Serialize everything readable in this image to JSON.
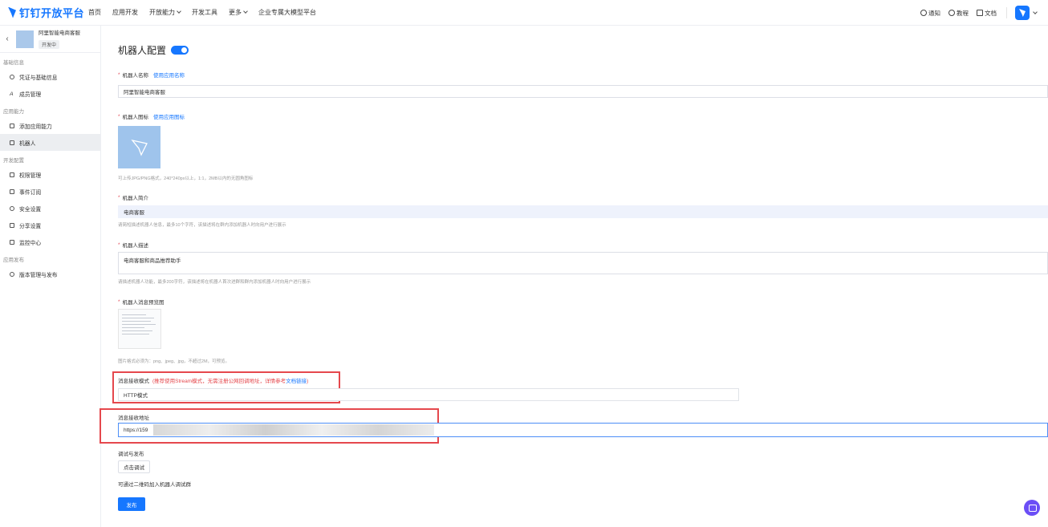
{
  "topbar": {
    "logo_text": "钉钉开放平台",
    "nav": [
      "首页",
      "应用开发",
      "开放能力",
      "开发工具",
      "更多",
      "企业专属大模型平台"
    ],
    "right": [
      "通知",
      "教程",
      "文档"
    ]
  },
  "sidebar": {
    "app_name": "阿里智能电商客服",
    "app_status": "开发中",
    "groups": [
      {
        "title": "基础信息",
        "items": [
          "凭证与基础信息",
          "成员管理"
        ]
      },
      {
        "title": "应用能力",
        "items": [
          "添加应用能力",
          "机器人"
        ]
      },
      {
        "title": "开发配置",
        "items": [
          "权限管理",
          "事件订阅",
          "安全设置",
          "分享设置",
          "监控中心"
        ]
      },
      {
        "title": "应用发布",
        "items": [
          "版本管理与发布"
        ]
      }
    ]
  },
  "main": {
    "title": "机器人配置",
    "robot_name_label": "机器人名称",
    "use_app_name": "使用应用名称",
    "robot_name_value": "阿里智能电商客服",
    "robot_icon_label": "机器人图标",
    "use_app_icon": "使用应用图标",
    "icon_hint": "可上传JPG/PNG格式，240*240px以上，1:1，2MB以内的无圆角图标",
    "intro_label": "机器人简介",
    "intro_value": "电商客服",
    "intro_hint": "请简短描述机器人信息，最多10个字符，该描述将在群内添加机器人时向用户进行展示",
    "desc_label": "机器人描述",
    "desc_value": "电商客服和商品推荐助手",
    "desc_hint": "请描述机器人功能，最多200字符，该描述将在机器人首次进群和群内添加机器人时向用户进行展示",
    "preview_label": "机器人消息预览图",
    "preview_hint": "图片格式必须为：png、jpeg、jpg，不超过2M，可预览。",
    "mode_label": "消息接收模式",
    "mode_warn": "(推荐使用Stream模式，无需注册公网回调地址，详情参考",
    "mode_link": "文档链接",
    "mode_warn_end": ")",
    "mode_value": "HTTP模式",
    "url_label": "消息接收地址",
    "url_value": "https://159",
    "debug_label": "调试与发布",
    "debug_button": "点击调试",
    "debug_hint": "可通过二维码加入机器人调试群",
    "publish_button": "发布"
  }
}
